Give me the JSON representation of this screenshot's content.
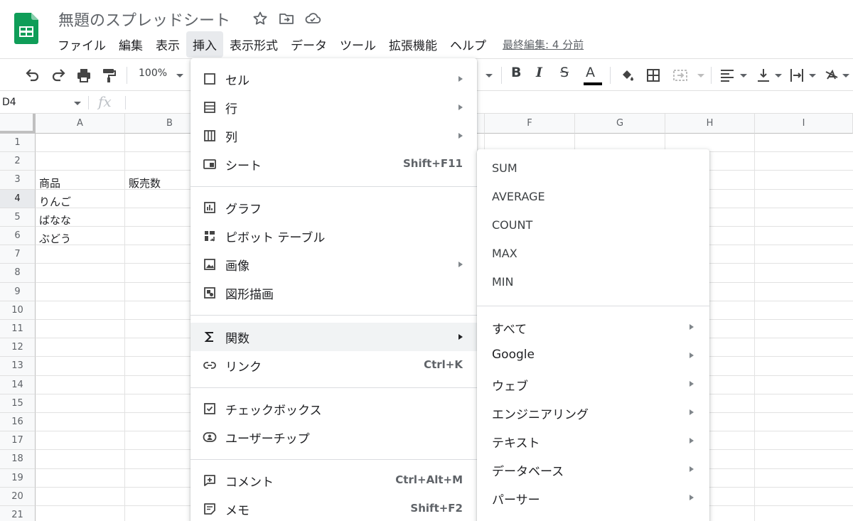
{
  "document": {
    "title": "無題のスプレッドシート",
    "last_edit": "最終編集: 4 分前"
  },
  "menubar": {
    "items": [
      "ファイル",
      "編集",
      "表示",
      "挿入",
      "表示形式",
      "データ",
      "ツール",
      "拡張機能",
      "ヘルプ"
    ],
    "active": "挿入"
  },
  "toolbar": {
    "zoom": "100%",
    "bold": "B",
    "italic": "I",
    "strike": "S",
    "text_color": "A"
  },
  "formula_bar": {
    "cell_ref": "D4",
    "fx": "fx"
  },
  "grid": {
    "columns": [
      "A",
      "B",
      "",
      "",
      "",
      "F",
      "G",
      "H",
      "I"
    ],
    "rows": [
      "1",
      "2",
      "3",
      "4",
      "5",
      "6",
      "7",
      "8",
      "9",
      "10",
      "11",
      "12",
      "13",
      "14",
      "15",
      "16",
      "17",
      "18",
      "19",
      "20",
      "21"
    ],
    "selected_row": "4",
    "cells": {
      "A3": "商品",
      "B3": "販売数",
      "A4": "りんご",
      "A5": "ばなな",
      "A6": "ぶどう"
    }
  },
  "insert_menu": {
    "items": [
      {
        "label": "セル",
        "icon": "cell-icon",
        "submenu": true
      },
      {
        "label": "行",
        "icon": "rows-icon",
        "submenu": true
      },
      {
        "label": "列",
        "icon": "columns-icon",
        "submenu": true
      },
      {
        "label": "シート",
        "icon": "sheet-icon",
        "shortcut": "Shift+F11"
      },
      {
        "label": "グラフ",
        "icon": "chart-icon"
      },
      {
        "label": "ピボット テーブル",
        "icon": "pivot-icon"
      },
      {
        "label": "画像",
        "icon": "image-icon",
        "submenu": true
      },
      {
        "label": "図形描画",
        "icon": "drawing-icon"
      },
      {
        "label": "関数",
        "icon": "sigma-icon",
        "submenu": true,
        "hovered": true
      },
      {
        "label": "リンク",
        "icon": "link-icon",
        "shortcut": "Ctrl+K"
      },
      {
        "label": "チェックボックス",
        "icon": "checkbox-icon"
      },
      {
        "label": "ユーザーチップ",
        "icon": "person-chip-icon"
      },
      {
        "label": "コメント",
        "icon": "comment-icon",
        "shortcut": "Ctrl+Alt+M"
      },
      {
        "label": "メモ",
        "icon": "note-icon",
        "shortcut": "Shift+F2"
      }
    ]
  },
  "function_menu": {
    "quick": [
      "SUM",
      "AVERAGE",
      "COUNT",
      "MAX",
      "MIN"
    ],
    "categories": [
      "すべて",
      "Google",
      "ウェブ",
      "エンジニアリング",
      "テキスト",
      "データベース",
      "パーサー"
    ]
  },
  "colors": {
    "logo_green": "#0F9D58",
    "grid_line": "#e2e2e2",
    "header_bg": "#f8f9fa",
    "menu_hover": "#f1f3f4"
  }
}
